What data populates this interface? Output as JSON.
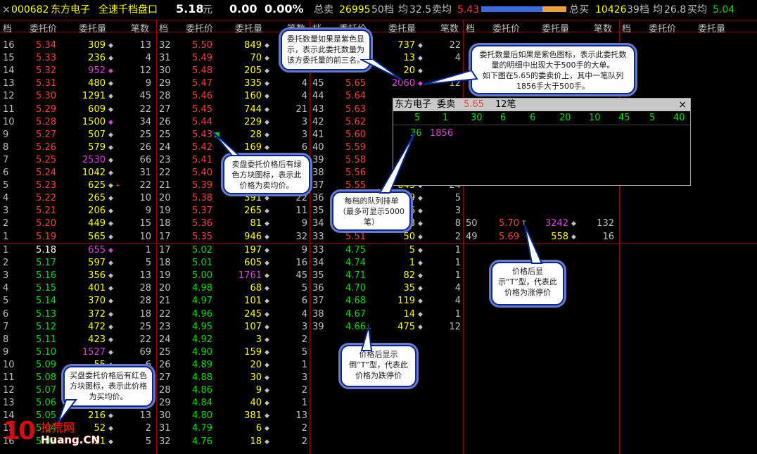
{
  "header": {
    "close": "×",
    "code": "000682",
    "name": "东方电子",
    "title": "全速千档盘口",
    "price": "5.18",
    "price_unit": "元",
    "change": "0.00",
    "change_pct": "0.00%",
    "sell_total_label": "总卖",
    "sell_total": "26995",
    "sell_levels": "50档",
    "sell_avg_label": "均",
    "sell_avg": "32.5",
    "sell_avg_price_label": "卖均",
    "sell_avg_price": "5.43",
    "buy_total_label": "总买",
    "buy_total": "10426",
    "buy_levels": "39档",
    "buy_avg_label": "均",
    "buy_avg": "26.8",
    "buy_avg_price_label": "买均",
    "buy_avg_price": "5.04",
    "bar_ratio": 0.72,
    "colors": {
      "up": "#ff3c3c",
      "down": "#00e000",
      "purple": "#e040e0",
      "yellow": "#ffff00",
      "cyan": "#00ffff",
      "orange": "#e8a040",
      "blue": "#3c6cd8"
    }
  },
  "columns": [
    "档",
    "委托价",
    "委托量",
    "笔数"
  ],
  "ask_block1": [
    [
      "16",
      "5.34",
      "309",
      "13"
    ],
    [
      "15",
      "5.33",
      "236",
      "4"
    ],
    [
      "14",
      "5.32",
      "952",
      "12"
    ],
    [
      "13",
      "5.31",
      "480",
      "9"
    ],
    [
      "12",
      "5.30",
      "1291",
      "45"
    ],
    [
      "11",
      "5.29",
      "609",
      "22"
    ],
    [
      "10",
      "5.28",
      "1500",
      "34"
    ],
    [
      "9",
      "5.27",
      "507",
      "25"
    ],
    [
      "8",
      "5.26",
      "579",
      "26"
    ],
    [
      "7",
      "5.25",
      "2530",
      "66"
    ],
    [
      "6",
      "5.24",
      "1042",
      "31"
    ],
    [
      "5",
      "5.23",
      "625",
      "22"
    ],
    [
      "4",
      "5.22",
      "265",
      "10"
    ],
    [
      "3",
      "5.21",
      "206",
      "9"
    ],
    [
      "2",
      "5.20",
      "449",
      "15"
    ],
    [
      "1",
      "5.19",
      "565",
      "10"
    ]
  ],
  "ask_block2": [
    [
      "32",
      "5.50",
      "849",
      ""
    ],
    [
      "31",
      "5.49",
      "70",
      ""
    ],
    [
      "30",
      "5.48",
      "205",
      ""
    ],
    [
      "29",
      "5.47",
      "335",
      "4"
    ],
    [
      "28",
      "5.46",
      "160",
      "4"
    ],
    [
      "27",
      "5.45",
      "744",
      "21"
    ],
    [
      "26",
      "5.44",
      "229",
      "3"
    ],
    [
      "25",
      "5.43",
      "28",
      "3"
    ],
    [
      "24",
      "5.42",
      "169",
      "6"
    ],
    [
      "23",
      "5.41",
      "",
      ""
    ],
    [
      "22",
      "5.40",
      "",
      ""
    ],
    [
      "21",
      "5.39",
      "",
      ""
    ],
    [
      "20",
      "5.38",
      "391",
      "22"
    ],
    [
      "19",
      "5.37",
      "265",
      "11"
    ],
    [
      "18",
      "5.36",
      "81",
      "9"
    ],
    [
      "17",
      "5.35",
      "946",
      "32"
    ]
  ],
  "ask_block3": [
    [
      "",
      "",
      "737",
      "22"
    ],
    [
      "",
      "",
      "13",
      "4"
    ],
    [
      "",
      "",
      "20",
      ""
    ],
    [
      "45",
      "5.65",
      "2060",
      "12"
    ],
    [
      "44",
      "5.64",
      "",
      ""
    ],
    [
      "43",
      "5.63",
      "",
      ""
    ],
    [
      "42",
      "5.62",
      "",
      ""
    ],
    [
      "41",
      "5.60",
      "",
      ""
    ],
    [
      "40",
      "5.59",
      "",
      ""
    ],
    [
      "39",
      "5.58",
      "",
      ""
    ],
    [
      "38",
      "5.56",
      "",
      ""
    ],
    [
      "37",
      "5.55",
      "643",
      "24"
    ],
    [
      "36",
      "",
      "79",
      "5"
    ],
    [
      "35",
      "",
      "56",
      "3"
    ],
    [
      "34",
      "",
      "58",
      "8"
    ],
    [
      "33",
      "5.51",
      "50",
      "2"
    ]
  ],
  "ask_block4": [
    [
      "50",
      "5.70",
      "3242",
      "132"
    ],
    [
      "49",
      "5.69",
      "558",
      "16"
    ]
  ],
  "bid_block1": [
    [
      "1",
      "5.18",
      "655",
      "1"
    ],
    [
      "2",
      "5.17",
      "597",
      "5"
    ],
    [
      "3",
      "5.16",
      "356",
      "13"
    ],
    [
      "4",
      "5.15",
      "401",
      "28"
    ],
    [
      "5",
      "5.14",
      "370",
      "28"
    ],
    [
      "6",
      "5.13",
      "372",
      "18"
    ],
    [
      "7",
      "5.12",
      "472",
      "25"
    ],
    [
      "8",
      "5.11",
      "423",
      "22"
    ],
    [
      "9",
      "5.10",
      "1527",
      "69"
    ],
    [
      "10",
      "5.09",
      "55",
      "6"
    ],
    [
      "11",
      "5.08",
      "",
      ""
    ],
    [
      "12",
      "5.07",
      "",
      ""
    ],
    [
      "13",
      "5.06",
      "",
      ""
    ],
    [
      "14",
      "5.05",
      "216",
      "13"
    ],
    [
      "15",
      "5.04",
      "52",
      "2"
    ],
    [
      "16",
      "5.03",
      "91",
      "5"
    ]
  ],
  "bid_block2": [
    [
      "17",
      "5.02",
      "197",
      "9"
    ],
    [
      "18",
      "5.01",
      "605",
      "16"
    ],
    [
      "19",
      "5.00",
      "1761",
      "45"
    ],
    [
      "20",
      "4.98",
      "68",
      "5"
    ],
    [
      "21",
      "4.97",
      "101",
      "6"
    ],
    [
      "22",
      "4.96",
      "245",
      "4"
    ],
    [
      "23",
      "4.95",
      "107",
      "3"
    ],
    [
      "24",
      "4.92",
      "3",
      "2"
    ],
    [
      "25",
      "4.90",
      "159",
      "5"
    ],
    [
      "26",
      "4.89",
      "20",
      "1"
    ],
    [
      "27",
      "4.88",
      "30",
      "3"
    ],
    [
      "28",
      "4.86",
      "9",
      "2"
    ],
    [
      "29",
      "4.84",
      "40",
      "1"
    ],
    [
      "30",
      "4.80",
      "381",
      "13"
    ],
    [
      "31",
      "4.79",
      "6",
      "2"
    ],
    [
      "32",
      "4.76",
      "18",
      "2"
    ]
  ],
  "bid_block3": [
    [
      "33",
      "4.75",
      "5",
      "1"
    ],
    [
      "34",
      "4.74",
      "1",
      "1"
    ],
    [
      "35",
      "4.71",
      "82",
      "1"
    ],
    [
      "36",
      "4.70",
      "35",
      "4"
    ],
    [
      "37",
      "4.68",
      "119",
      "4"
    ],
    [
      "38",
      "4.67",
      "14",
      "1"
    ],
    [
      "39",
      "4.66",
      "475",
      "12"
    ]
  ],
  "popup": {
    "name": "东方电子",
    "type": "委卖",
    "price": "5.65",
    "count": "12笔",
    "close": "×",
    "queue_row1": [
      "5",
      "1",
      "30",
      "6",
      "6",
      "20",
      "10",
      "45",
      "5",
      "40"
    ],
    "queue_row2": [
      "36",
      "1856"
    ]
  },
  "tips": {
    "t1": "委托数量如果是紫色显示，表示此委托数量为该方委托量的前三名。",
    "t2a": "委托数量后如果是紫色图标，表示此委托数量的明细中出现大于500手的大单。",
    "t2b": "如下图在5.65的委卖价上，其中一笔队列1856手大于500手。",
    "t3": "卖盘委托价格后有绿色方块图标，表示此价格为卖均价。",
    "t4a": "每档的队列排单",
    "t4b": "（最多可显示5000笔）",
    "t5": "价格后显示“T”型，代表此价格为涨停价",
    "t6": "价格后显示倒“T”型，代表此价格为跌停价",
    "t7": "买盘委托价格后有红色方块图标，表示此价格为买均价。"
  },
  "logo": {
    "num": "10",
    "cn": "拾荒网",
    "en": "Huang.CN"
  }
}
